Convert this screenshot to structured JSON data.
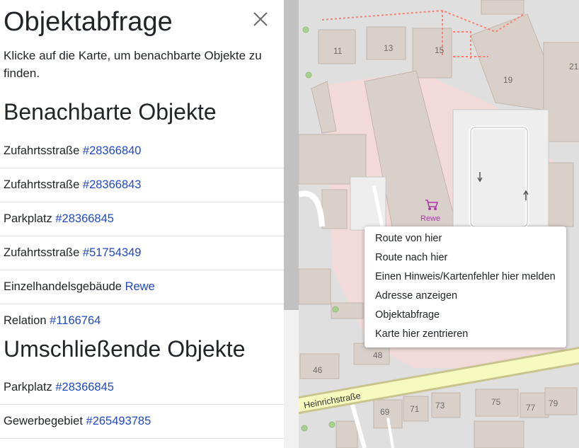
{
  "sidebar": {
    "title": "Objektabfrage",
    "intro": "Klicke auf die Karte, um benachbarte Objekte zu finden.",
    "nearby_heading": "Benachbarte Objekte",
    "nearby": [
      {
        "type": "Zufahrtsstraße",
        "link": "#28366840"
      },
      {
        "type": "Zufahrtsstraße",
        "link": "#28366843"
      },
      {
        "type": "Parkplatz",
        "link": "#28366845"
      },
      {
        "type": "Zufahrtsstraße",
        "link": "#51754349"
      },
      {
        "type": "Einzelhandelsgebäude",
        "link": "Rewe"
      },
      {
        "type": "Relation",
        "link": "#1166764"
      }
    ],
    "enclosing_heading": "Umschließende Objekte",
    "enclosing": [
      {
        "type": "Parkplatz",
        "link": "#28366845"
      },
      {
        "type": "Gewerbegebiet",
        "link": "#265493785"
      }
    ]
  },
  "context_menu": [
    "Route von hier",
    "Route nach hier",
    "Einen Hinweis/Kartenfehler hier melden",
    "Adresse anzeigen",
    "Objektabfrage",
    "Karte hier zentrieren"
  ],
  "map": {
    "street_name": "Heinrichstraße",
    "shop_label": "Rewe",
    "house_numbers": [
      "11",
      "13",
      "15",
      "19",
      "21",
      "46",
      "48",
      "69",
      "71",
      "73",
      "75",
      "77",
      "79"
    ],
    "colors": {
      "building": "#d9d0c9",
      "building_outline": "#c4b6ab",
      "landuse": "#f2dad9",
      "parking": "#eeeeee",
      "road": "#f7fabf",
      "road_casing": "#c8c48f",
      "shop": "#ac39ac",
      "link": "#2149c2"
    }
  }
}
